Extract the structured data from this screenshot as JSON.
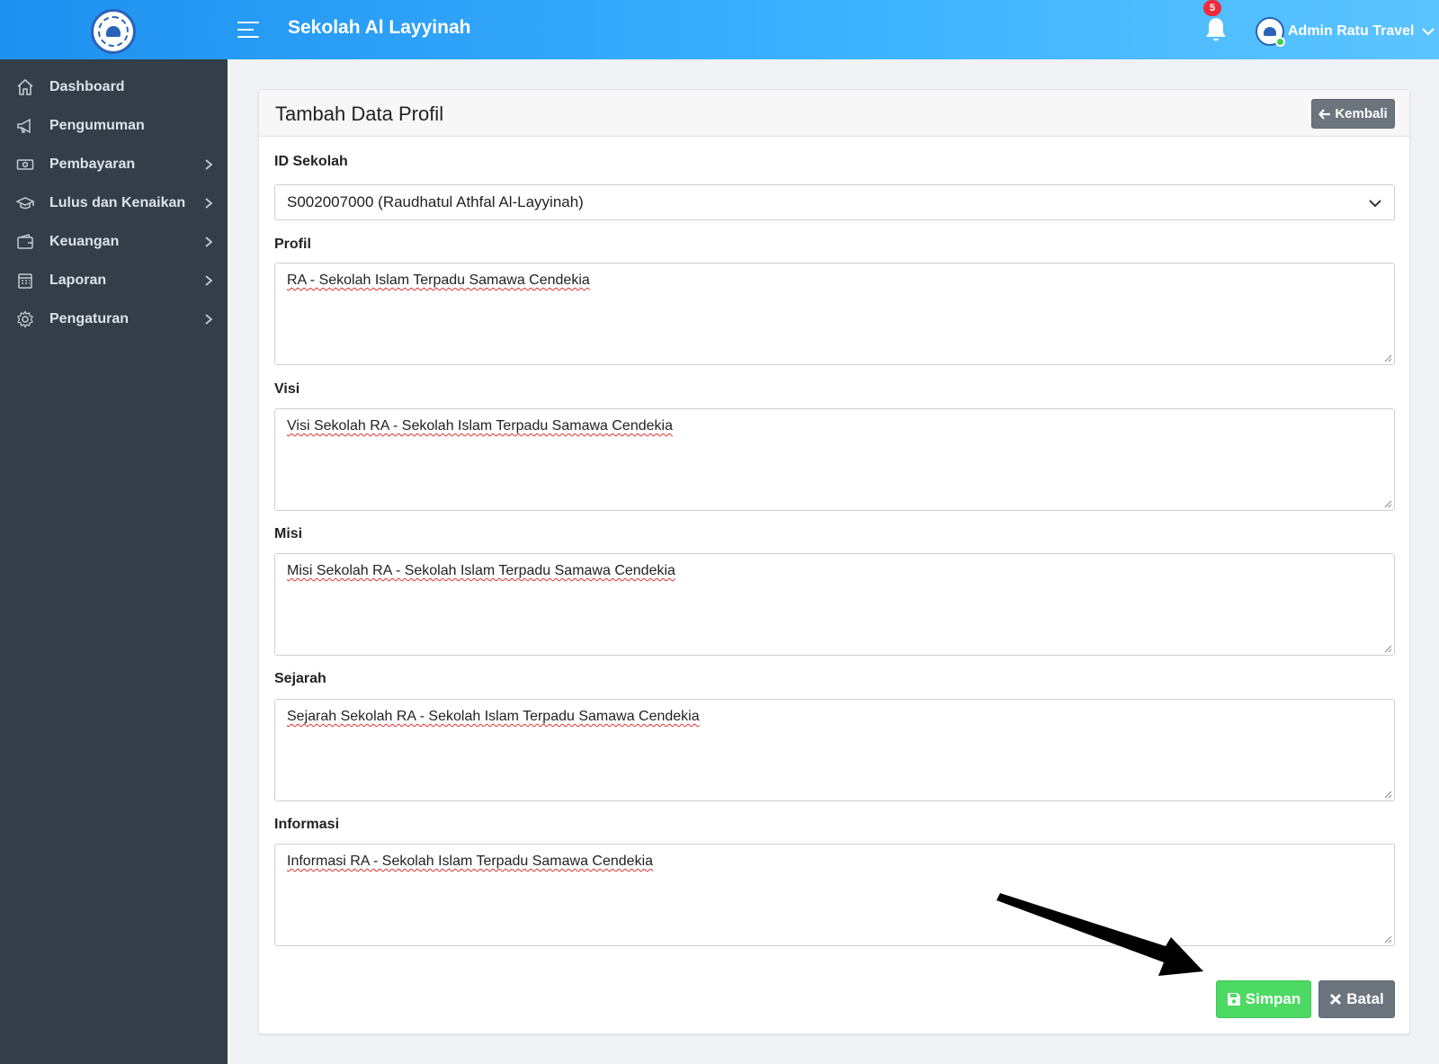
{
  "header": {
    "app_title": "Sekolah Al Layyinah",
    "notification_count": "5",
    "user_name": "Admin Ratu Travel"
  },
  "sidebar": {
    "items": [
      {
        "label": "Dashboard",
        "icon": "home-icon"
      },
      {
        "label": "Pengumuman",
        "icon": "megaphone-icon"
      },
      {
        "label": "Pembayaran",
        "icon": "money-icon"
      },
      {
        "label": "Lulus dan Kenaikan",
        "icon": "graduation-cap-icon"
      },
      {
        "label": "Keuangan",
        "icon": "wallet-icon"
      },
      {
        "label": "Laporan",
        "icon": "calendar-icon"
      },
      {
        "label": "Pengaturan",
        "icon": "gear-icon"
      }
    ]
  },
  "form": {
    "title": "Tambah Data Profil",
    "back_label": "Kembali",
    "id_sekolah_label": "ID Sekolah",
    "id_sekolah_value": "S002007000 (Raudhatul Athfal Al-Layyinah)",
    "fields": [
      {
        "label": "Profil",
        "value": "RA - Sekolah Islam Terpadu Samawa Cendekia"
      },
      {
        "label": "Visi",
        "value": "Visi Sekolah RA - Sekolah Islam Terpadu Samawa Cendekia"
      },
      {
        "label": "Misi",
        "value": "Misi Sekolah RA - Sekolah Islam Terpadu Samawa Cendekia"
      },
      {
        "label": "Sejarah",
        "value": "Sejarah Sekolah RA - Sekolah Islam Terpadu Samawa Cendekia"
      },
      {
        "label": "Informasi",
        "value": "Informasi RA - Sekolah Islam Terpadu Samawa Cendekia"
      }
    ],
    "save_label": "Simpan",
    "cancel_label": "Batal"
  },
  "colors": {
    "topbar": "#2ea3f7",
    "sidebar": "#333e48",
    "save": "#4cd964",
    "secondary": "#6c757d"
  }
}
